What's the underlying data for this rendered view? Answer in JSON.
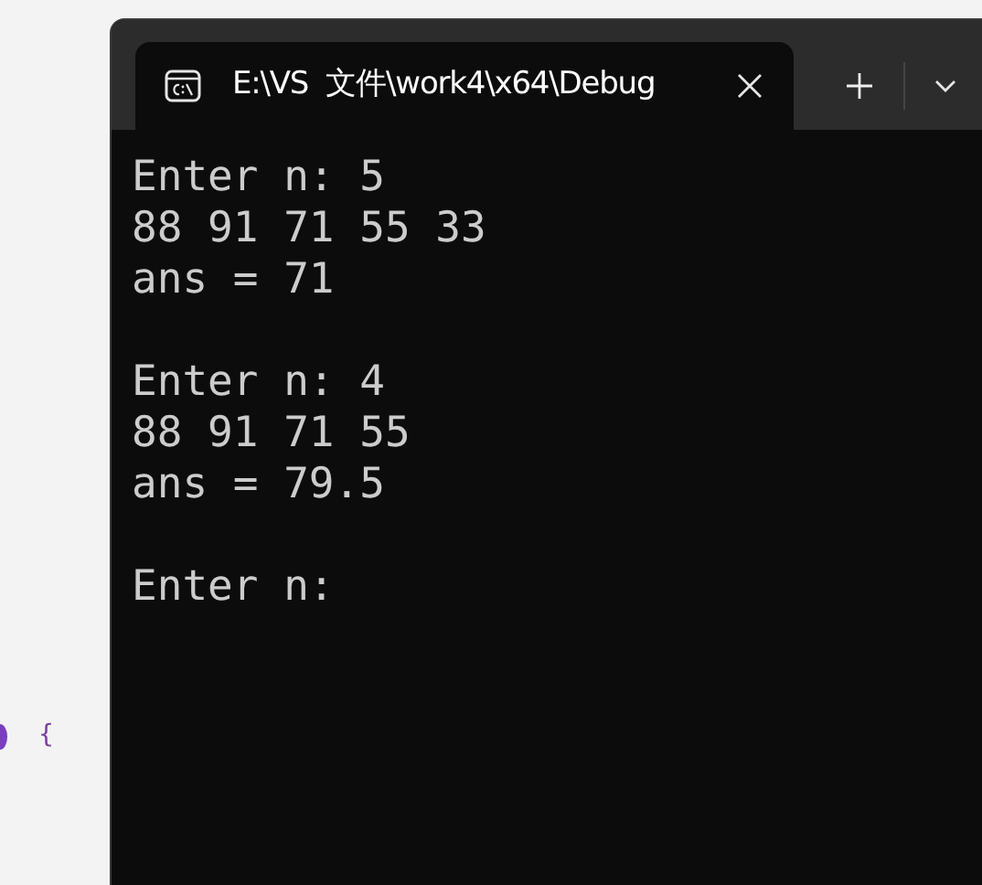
{
  "editor_background": {
    "code_fragment": "{"
  },
  "window": {
    "tab": {
      "title": "E:\\VS  文件\\work4\\x64\\Debug",
      "selected": true
    }
  },
  "console": {
    "blocks": [
      [
        "Enter n: 5",
        "88 91 71 55 33",
        "ans = 71"
      ],
      [
        "Enter n: 4",
        "88 91 71 55",
        "ans = 79.5"
      ],
      [
        "Enter n:"
      ]
    ]
  }
}
